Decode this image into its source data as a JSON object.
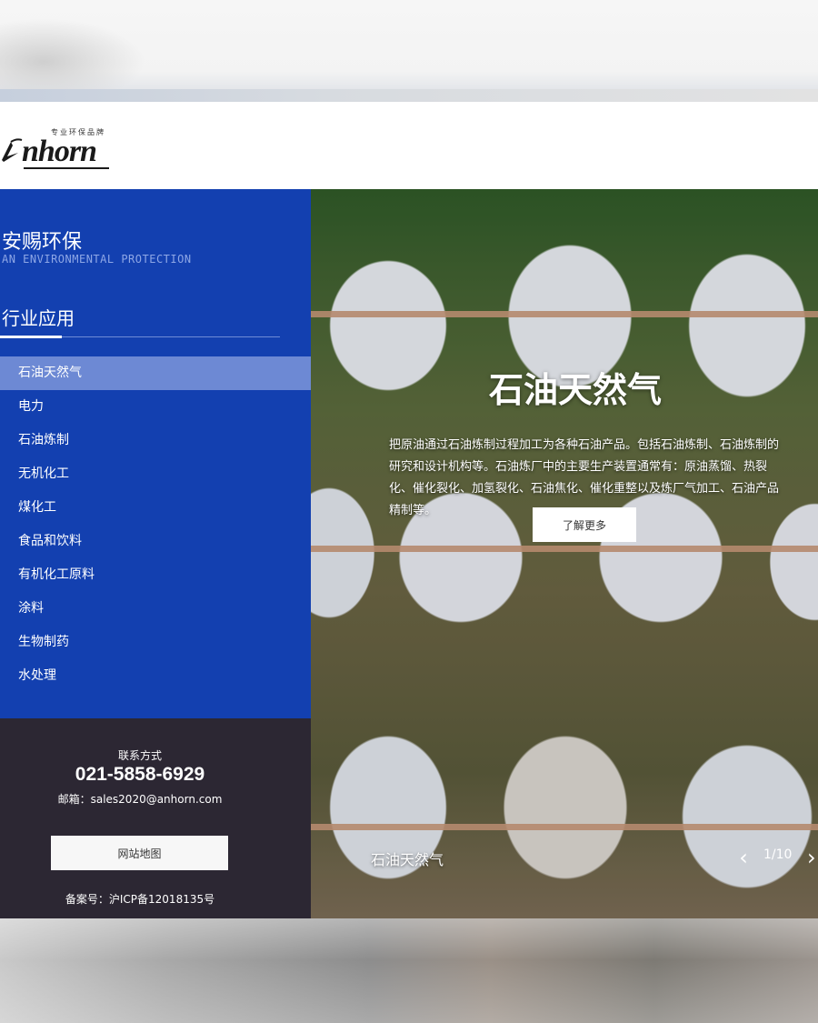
{
  "logo": {
    "word": "nhorn",
    "tagline": "专业环保品牌",
    "icon": "bird-mark-icon"
  },
  "sidebar": {
    "brand_cn": "安赐环保",
    "brand_en": "AN ENVIRONMENTAL PROTECTION",
    "section_title": "行业应用",
    "items": [
      {
        "label": "石油天然气",
        "active": true
      },
      {
        "label": "电力"
      },
      {
        "label": "石油炼制"
      },
      {
        "label": "无机化工"
      },
      {
        "label": "煤化工"
      },
      {
        "label": "食品和饮料"
      },
      {
        "label": "有机化工原料"
      },
      {
        "label": "涂料"
      },
      {
        "label": "生物制药"
      },
      {
        "label": "水处理"
      }
    ]
  },
  "contact": {
    "label": "联系方式",
    "phone": "021-5858-6929",
    "email": "邮箱：sales2020@anhorn.com",
    "sitemap_label": "网站地图",
    "icp": "备案号：沪ICP备12018135号"
  },
  "hero": {
    "title": "石油天然气",
    "description": "把原油通过石油炼制过程加工为各种石油产品。包括石油炼制、石油炼制的研究和设计机构等。石油炼厂中的主要生产装置通常有：原油蒸馏、热裂化、催化裂化、加氢裂化、石油焦化、催化重整以及炼厂气加工、石油产品精制等。",
    "more_label": "了解更多",
    "caption": "石油天然气",
    "pager": "1/10",
    "prev_icon": "chevron-left-icon",
    "next_icon": "chevron-right-icon"
  },
  "colors": {
    "sidebar_blue": "#1340b0",
    "active_item": "#6d89d4",
    "contact_bg": "#2c2733"
  }
}
